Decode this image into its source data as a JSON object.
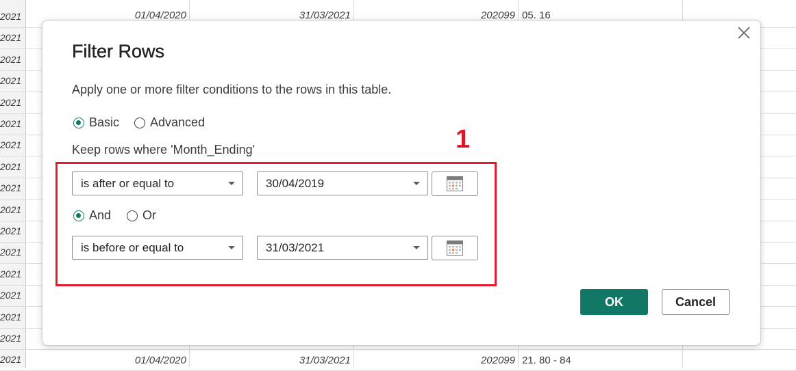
{
  "background_sheet": {
    "row_numbers": [
      "2021",
      "2021",
      "2021",
      "2021",
      "2021",
      "2021",
      "2021",
      "2021",
      "2021",
      "2021",
      "2021",
      "2021",
      "2021",
      "2021",
      "2021",
      "2021",
      "2021"
    ],
    "top_row": {
      "start_date": "01/04/2020",
      "end_date": "31/03/2021",
      "period": "202099",
      "label": "05. 16"
    },
    "bottom_row": {
      "start_date": "01/04/2020",
      "end_date": "31/03/2021",
      "period": "202099",
      "label": "21. 80 - 84"
    }
  },
  "dialog": {
    "title": "Filter Rows",
    "description": "Apply one or more filter conditions to the rows in this table.",
    "mode_options": {
      "basic": "Basic",
      "advanced": "Advanced",
      "selected": "Basic"
    },
    "keep_rows_label": "Keep rows where 'Month_Ending'",
    "condition1": {
      "operator": "is after or equal to",
      "value": "30/04/2019"
    },
    "logic_options": {
      "and": "And",
      "or": "Or",
      "selected": "And"
    },
    "condition2": {
      "operator": "is before or equal to",
      "value": "31/03/2021"
    },
    "ok_label": "OK",
    "cancel_label": "Cancel"
  },
  "annotation": {
    "number": "1",
    "color": "#e11b2d"
  },
  "colors": {
    "accent": "#117865"
  }
}
